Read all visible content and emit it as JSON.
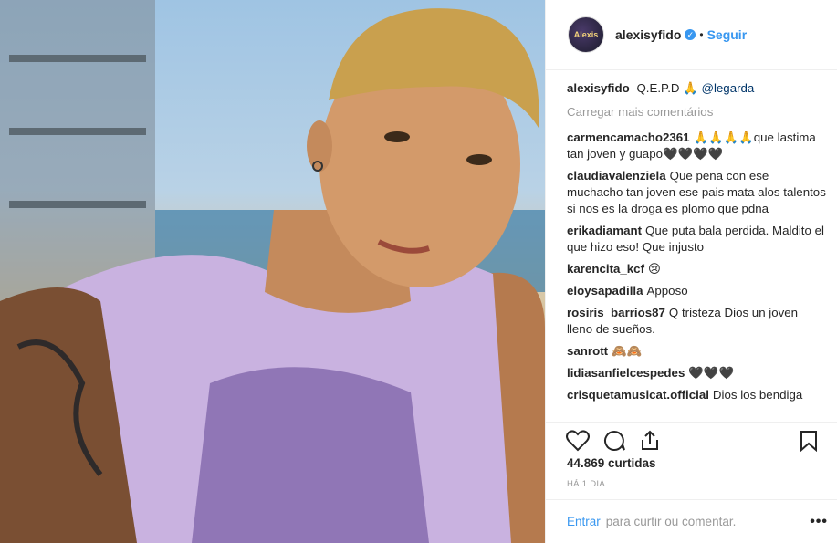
{
  "header": {
    "username": "alexisyfido",
    "verified_glyph": "✓",
    "separator": "•",
    "follow_label": "Seguir",
    "avatar_text": "Alexis"
  },
  "caption": {
    "username": "alexisyfido",
    "text": "Q.E.P.D 🙏",
    "mention": "@legarda"
  },
  "load_more": "Carregar mais comentários",
  "comments": [
    {
      "user": "carmencamacho2361",
      "text": "🙏🙏🙏🙏que lastima tan joven y guapo🖤🖤🖤🖤"
    },
    {
      "user": "claudiavalenziela",
      "text": "Que pena con ese muchacho tan joven ese pais mata alos talentos si nos es la droga es plomo que pdna"
    },
    {
      "user": "erikadiamant",
      "text": "Que puta bala perdida. Maldito el que hizo eso! Que injusto"
    },
    {
      "user": "karencita_kcf",
      "text": "😢"
    },
    {
      "user": "eloysapadilla",
      "text": "Apposo"
    },
    {
      "user": "rosiris_barrios87",
      "text": "Q tristeza Dios un joven lleno de sueños."
    },
    {
      "user": "sanrott",
      "text": "🙈🙈"
    },
    {
      "user": "lidiasanfielcespedes",
      "text": "🖤🖤🖤"
    },
    {
      "user": "crisquetamusicat.official",
      "text": "Dios los bendiga"
    }
  ],
  "likes": "44.869 curtidas",
  "timestamp": "HÁ 1 DIA",
  "footer": {
    "enter_label": "Entrar",
    "tail_text": "para curtir ou comentar.",
    "more_label": "•••"
  },
  "icons": [
    "heart-icon",
    "comment-icon",
    "share-icon",
    "bookmark-icon",
    "more-options-icon"
  ]
}
